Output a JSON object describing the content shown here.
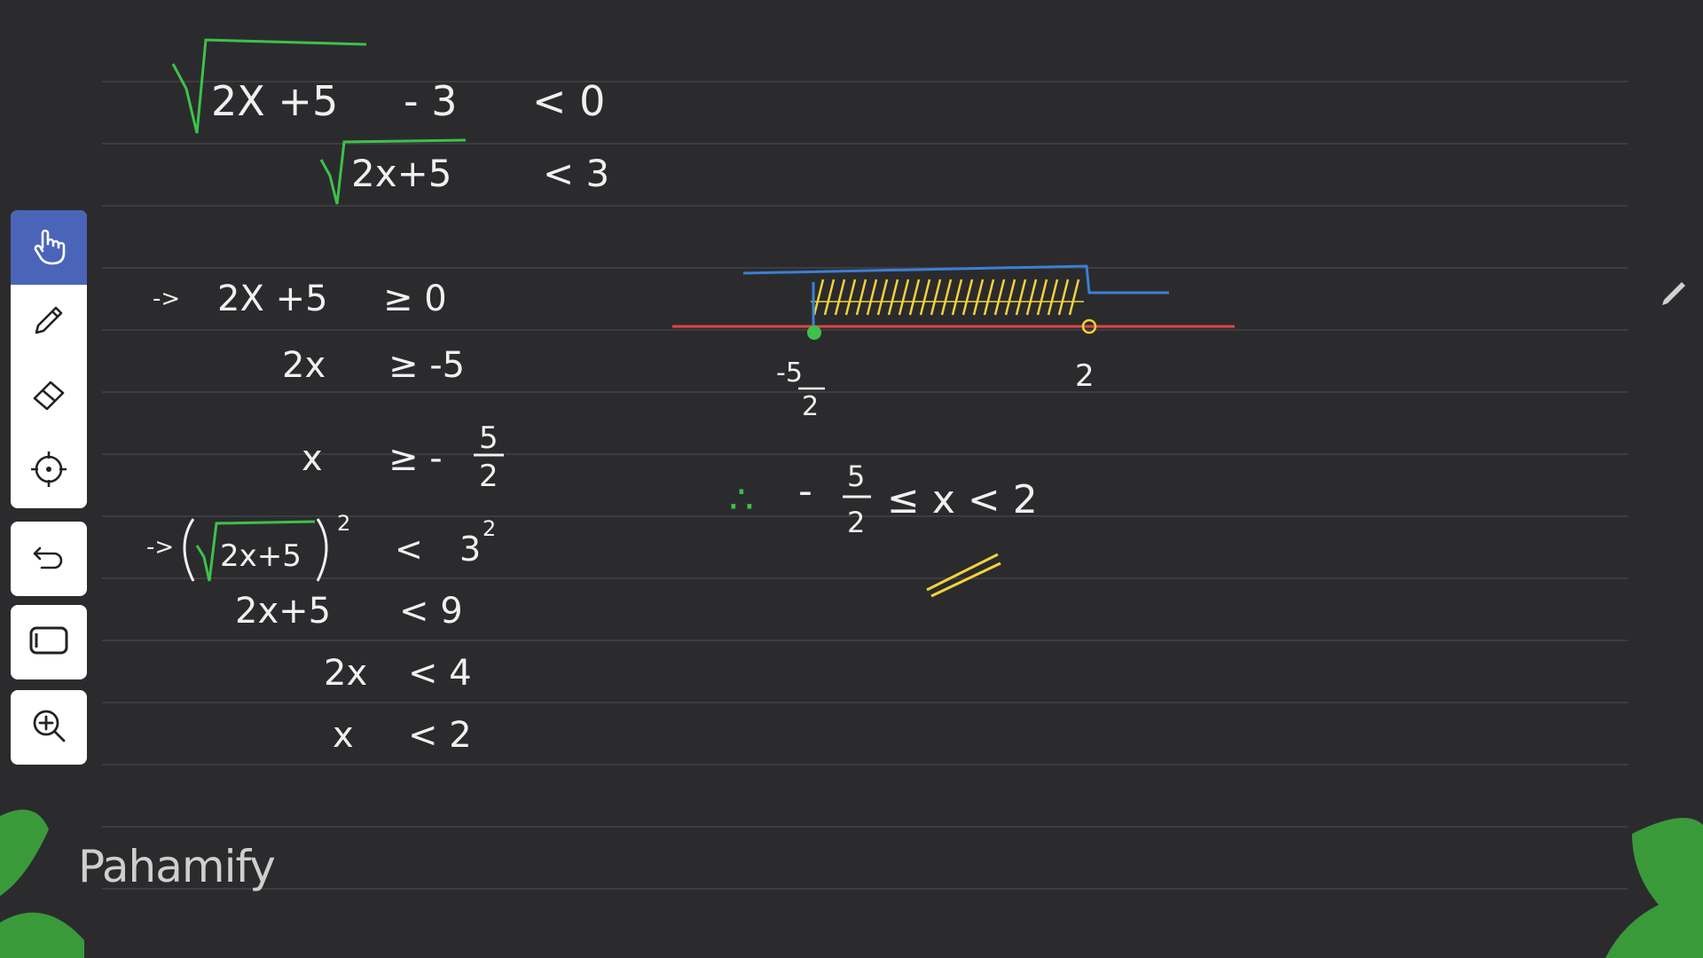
{
  "board": {
    "ruled_line_color": "#3d3d40",
    "background": "#2b2b2d"
  },
  "colors": {
    "green": "#3ec14b",
    "yellow": "#f3d23a",
    "white": "#e8e8e8",
    "blue": "#3b7fd6",
    "red": "#e04545",
    "leaf": "#3a9a3a"
  },
  "math": {
    "line1_left": "2X +5",
    "line1_minus": "- 3",
    "line1_right": "< 0",
    "line2_left": "2x+5",
    "line2_right": "< 3",
    "cond1_arrow": "->",
    "cond1": "2X +5",
    "cond1_rel": "≥ 0",
    "cond2_left": "2x",
    "cond2_rel": "≥ -5",
    "cond3_left": "x",
    "cond3_rel": "≥ -",
    "cond3_num": "5",
    "cond3_den": "2",
    "sq_arrow": "->",
    "sq_inner": "2x+5",
    "sq_exp": "2",
    "sq_rel": "<",
    "sq_rhs": "3",
    "sq_rhs_exp": "2",
    "s2_left": "2x+5",
    "s2_rel": "< 9",
    "s3_left": "2x",
    "s3_rel": "< 4",
    "s4_left": "x",
    "s4_rel": "< 2",
    "numline_left_num": "-5",
    "numline_left_den": "2",
    "numline_right": "2",
    "answer_therefore": "∴",
    "answer_minus": "-",
    "answer_num": "5",
    "answer_den": "2",
    "answer_rest": "≤ x < 2"
  },
  "toolbar": {
    "tools": [
      {
        "name": "hand-icon",
        "active": true
      },
      {
        "name": "pen-icon",
        "active": false
      },
      {
        "name": "eraser-icon",
        "active": false
      },
      {
        "name": "laser-pointer-icon",
        "active": false
      }
    ],
    "undo": "undo-icon",
    "shape": "rectangle-icon",
    "zoom": "zoom-in-icon"
  },
  "brand": {
    "name": "Pahamify"
  }
}
